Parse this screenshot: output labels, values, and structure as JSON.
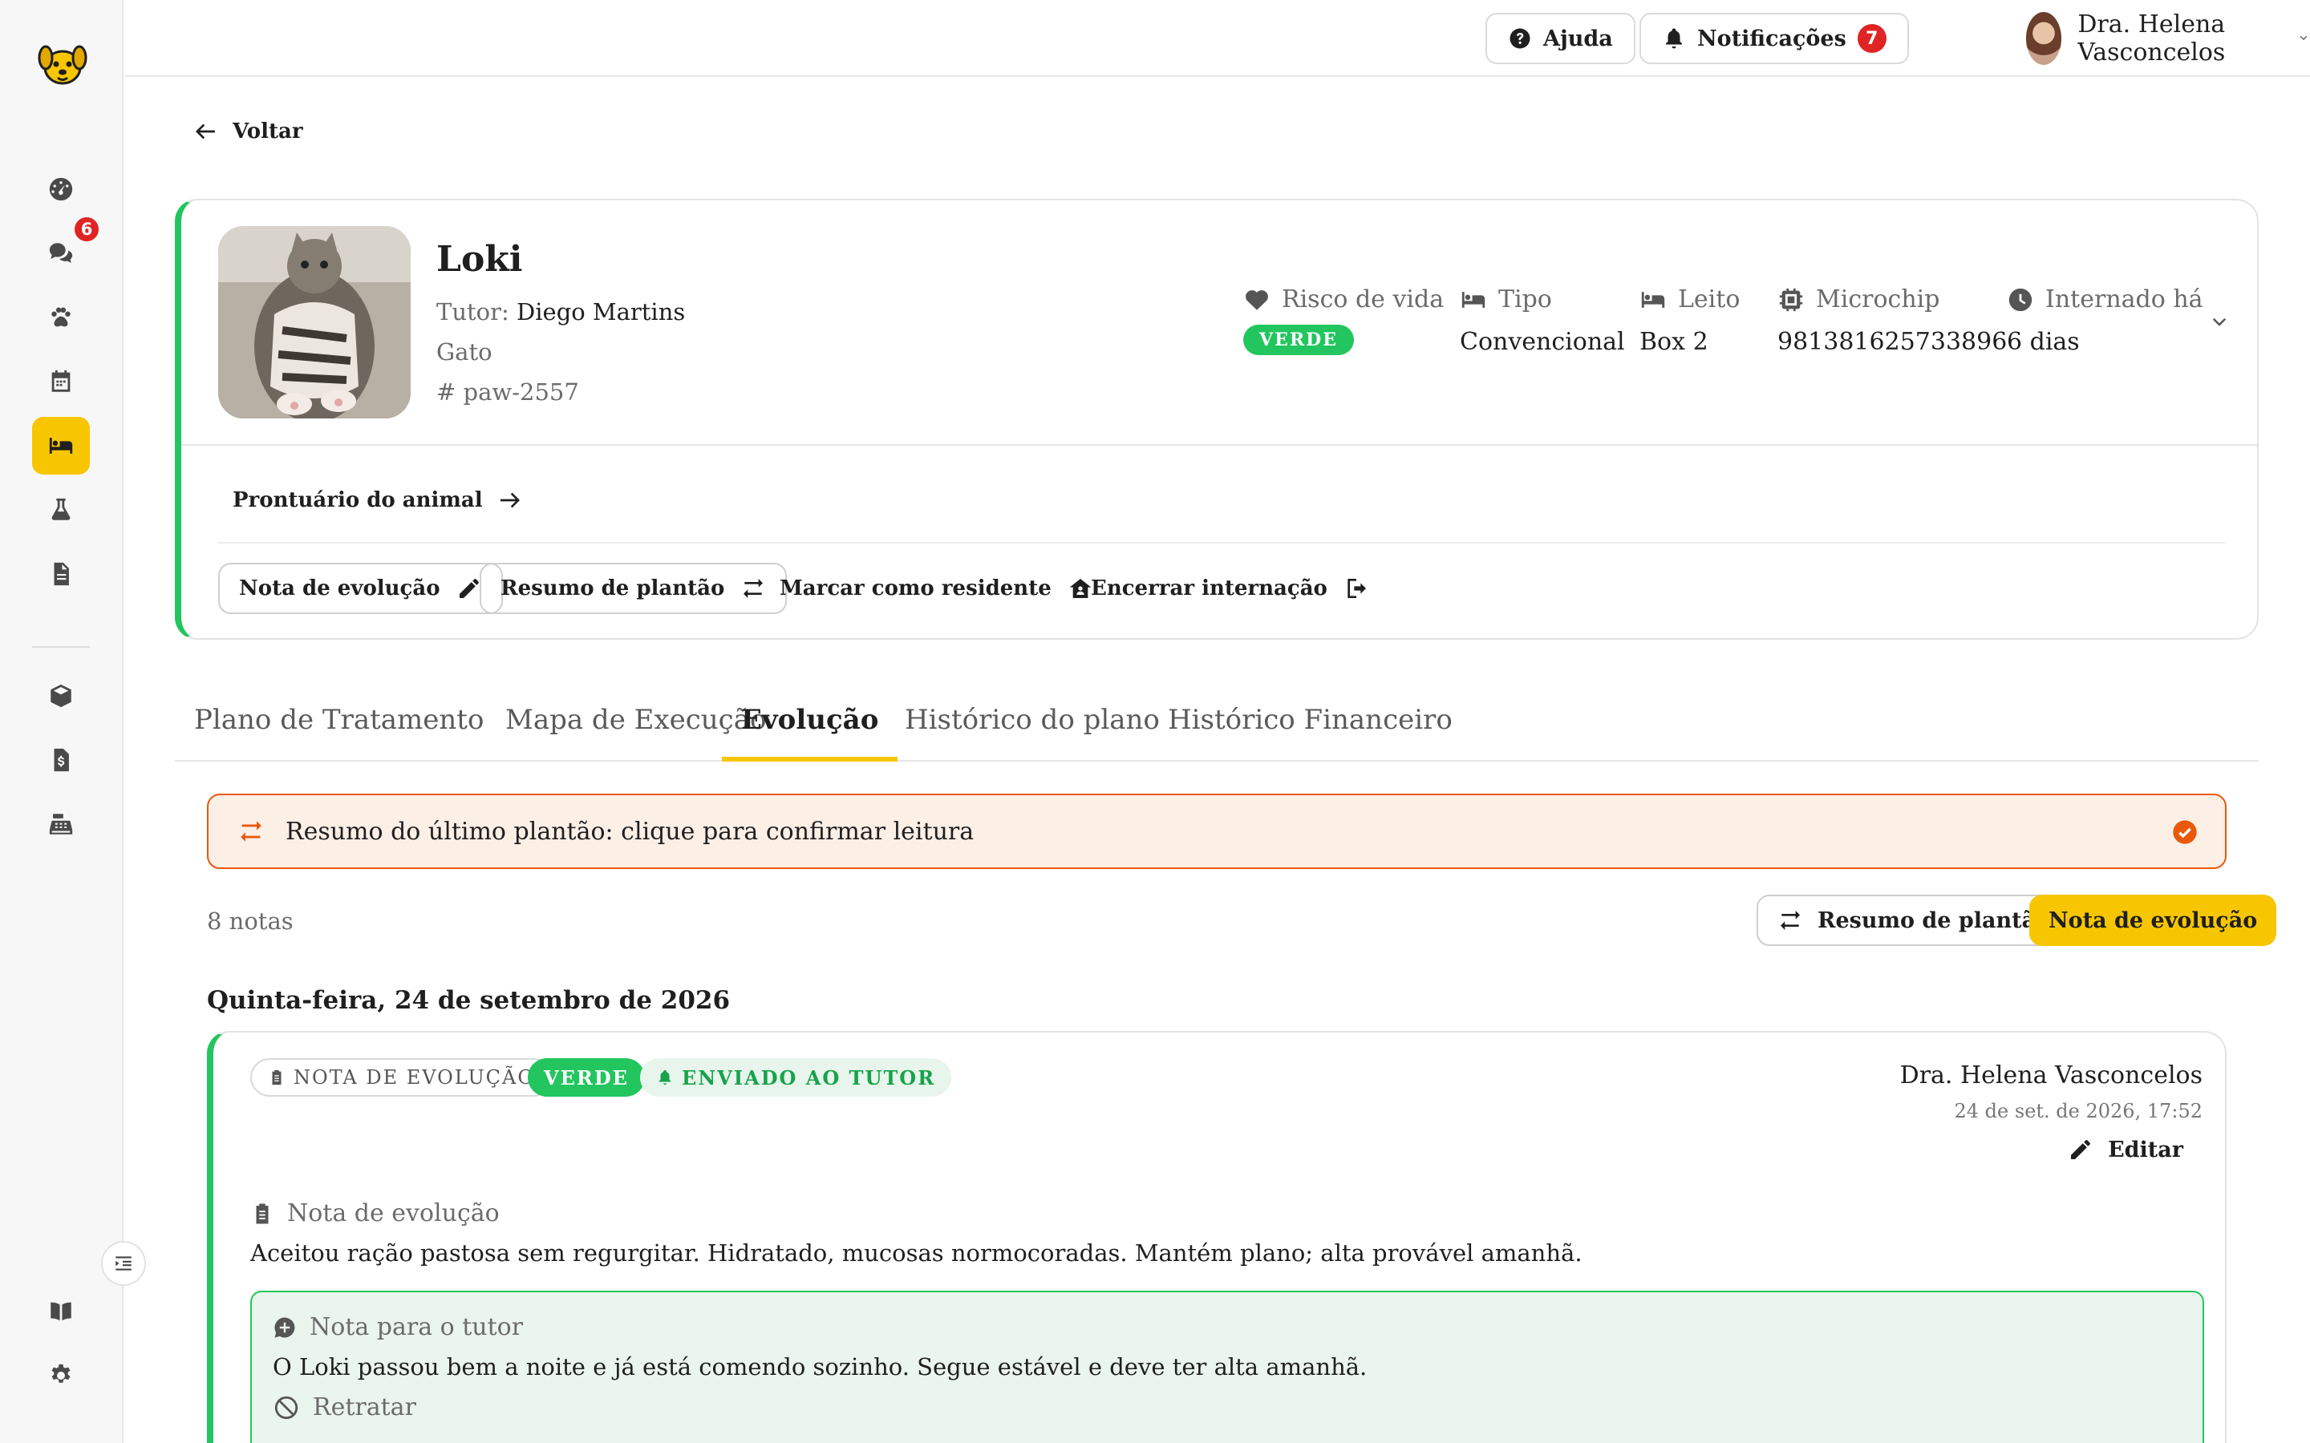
{
  "topbar": {
    "help_label": "Ajuda",
    "notifications_label": "Notificações",
    "notifications_count": "7",
    "user_name": "Dra. Helena Vasconcelos"
  },
  "sidebar": {
    "chat_badge": "6"
  },
  "back_label": "Voltar",
  "patient": {
    "name": "Loki",
    "tutor_label": "Tutor:",
    "tutor_name": "Diego Martins",
    "species": "Gato",
    "id_hash": "#",
    "id": "paw-2557",
    "stats": {
      "risk_label": "Risco de vida",
      "risk_value": "VERDE",
      "type_label": "Tipo",
      "type_value": "Convencional",
      "bed_label": "Leito",
      "bed_value": "Box 2",
      "chip_label": "Microchip",
      "chip_value": "981381625733896",
      "stay_label": "Internado há",
      "stay_value": "6 dias"
    },
    "record_link": "Prontuário do animal",
    "actions": {
      "evolution_note": "Nota de evolução",
      "shift_summary": "Resumo de plantão",
      "mark_resident": "Marcar como residente",
      "end_stay": "Encerrar internação"
    }
  },
  "tabs": [
    {
      "label": "Plano de Tratamento"
    },
    {
      "label": "Mapa de Execução"
    },
    {
      "label": "Evolução"
    },
    {
      "label": "Histórico do plano"
    },
    {
      "label": "Histórico Financeiro"
    }
  ],
  "alert": {
    "text": "Resumo do último plantão: clique para confirmar leitura"
  },
  "notes_toolbar": {
    "count": "8 notas",
    "shift_summary_btn": "Resumo de plantão",
    "evolution_note_btn": "Nota de evolução"
  },
  "date_heading": "Quinta-feira, 24 de setembro de 2026",
  "note": {
    "tag_type": "NOTA DE EVOLUÇÃO",
    "tag_risk": "VERDE",
    "tag_sent": "ENVIADO AO TUTOR",
    "author": "Dra. Helena Vasconcelos",
    "timestamp": "24 de set. de 2026, 17:52",
    "edit_label": "Editar",
    "body_label": "Nota de evolução",
    "body_text": "Aceitou ração pastosa sem regurgitar. Hidratado, mucosas normocoradas. Mantém plano; alta provável amanhã.",
    "tutor_label": "Nota para o tutor",
    "tutor_text": "O Loki passou bem a noite e já está comendo sozinho. Segue estável e deve ter alta amanhã.",
    "retract_label": "Retratar"
  },
  "colors": {
    "accent": "#f7c600",
    "success": "#22c55e",
    "alert": "#ea580c",
    "badge": "#e02424"
  }
}
